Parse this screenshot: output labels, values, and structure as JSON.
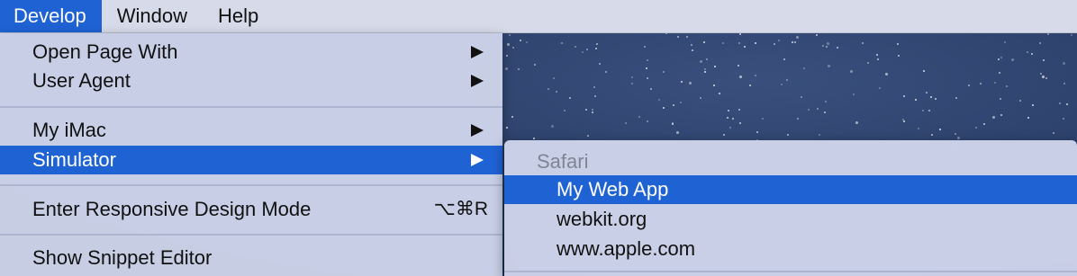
{
  "menubar": {
    "items": [
      {
        "label": "Develop"
      },
      {
        "label": "Window"
      },
      {
        "label": "Help"
      }
    ]
  },
  "develop_menu": {
    "items": [
      {
        "label": "Open Page With"
      },
      {
        "label": "User Agent"
      },
      {
        "label": "My iMac"
      },
      {
        "label": "Simulator"
      },
      {
        "label": "Enter Responsive Design Mode",
        "shortcut": "⌥⌘R"
      },
      {
        "label": "Show Snippet Editor"
      }
    ]
  },
  "simulator_submenu": {
    "header": "Safari",
    "items": [
      {
        "label": "My Web App"
      },
      {
        "label": "webkit.org"
      },
      {
        "label": "www.apple.com"
      }
    ]
  },
  "colors": {
    "accent": "#1f62d4",
    "menu_bg": "#ced4ea",
    "desktop": "#2a3f69"
  }
}
